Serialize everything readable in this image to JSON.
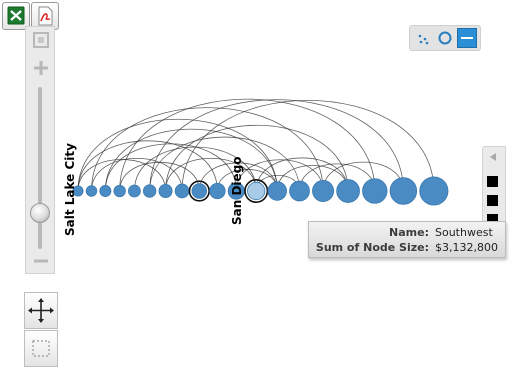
{
  "toolbar": {
    "export_excel_icon": "excel-icon",
    "export_pdf_icon": "pdf-icon"
  },
  "zoom": {
    "fit_icon": "fit-to-screen-icon",
    "zoom_in_icon": "plus-icon",
    "zoom_out_icon": "minus-icon",
    "zoom_level": 0.18
  },
  "tools": {
    "pan_icon": "move-arrows-icon",
    "select_icon": "marquee-select-icon"
  },
  "layouts": {
    "items": [
      {
        "icon": "scatter-layout-icon",
        "selected": false
      },
      {
        "icon": "circle-layout-icon",
        "selected": false
      },
      {
        "icon": "arc-layout-icon",
        "selected": true
      }
    ]
  },
  "legend": {
    "collapse_icon": "triangle-left-icon",
    "swatch_count": 3
  },
  "graph": {
    "labels": [
      "Salt Lake City",
      "San Diego"
    ],
    "node_sizes": [
      0.06,
      0.08,
      0.1,
      0.12,
      0.14,
      0.17,
      0.2,
      0.23,
      0.27,
      0.31,
      0.35,
      0.4,
      0.46,
      0.52,
      0.58,
      0.66,
      0.74,
      0.84,
      0.92
    ],
    "selected_index": 11,
    "highlighted_index": 8,
    "node_color": "#4a8bc4",
    "node_stroke": "#3a79b0",
    "selected_fill": "#a8cbe8",
    "edges": [
      [
        0,
        6
      ],
      [
        0,
        9
      ],
      [
        0,
        12
      ],
      [
        1,
        7
      ],
      [
        1,
        14
      ],
      [
        2,
        10
      ],
      [
        3,
        8
      ],
      [
        3,
        16
      ],
      [
        4,
        11
      ],
      [
        5,
        13
      ],
      [
        5,
        17
      ],
      [
        6,
        15
      ],
      [
        7,
        18
      ],
      [
        8,
        12
      ],
      [
        9,
        12
      ],
      [
        10,
        14
      ],
      [
        11,
        13
      ],
      [
        12,
        15
      ],
      [
        13,
        16
      ],
      [
        14,
        17
      ],
      [
        11,
        15
      ],
      [
        2,
        12
      ],
      [
        6,
        11
      ]
    ]
  },
  "tooltip": {
    "name_label": "Name:",
    "name_value": "Southwest",
    "size_label": "Sum of Node Size:",
    "size_value": "$3,132,800"
  }
}
